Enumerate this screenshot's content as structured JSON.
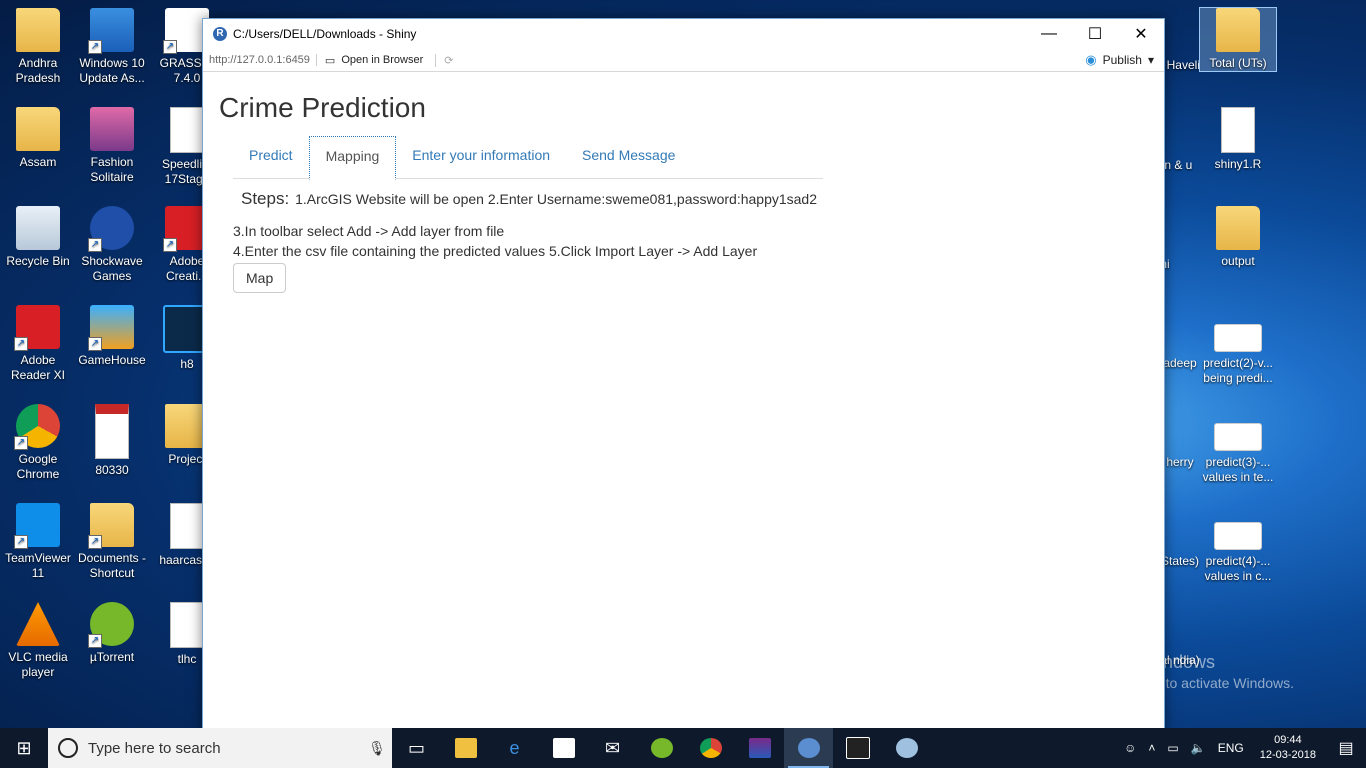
{
  "desktop_icons": [
    {
      "label": "Andhra Pradesh",
      "icon": "folder-icon"
    },
    {
      "label": "Windows 10 Update As...",
      "icon": "windows-update-icon"
    },
    {
      "label": "GRASS G 7.4.0",
      "icon": "grass-gis-icon"
    },
    {
      "label": "Assam",
      "icon": "folder-icon"
    },
    {
      "label": "Fashion Solitaire",
      "icon": "game-icon"
    },
    {
      "label": "Speedlim 17Stage",
      "icon": "file-icon"
    },
    {
      "label": "Recycle Bin",
      "icon": "recycle-bin-icon"
    },
    {
      "label": "Shockwave Games",
      "icon": "shockwave-icon"
    },
    {
      "label": "Adobe Creati...",
      "icon": "adobe-cc-icon"
    },
    {
      "label": "Adobe Reader XI",
      "icon": "adobe-reader-icon"
    },
    {
      "label": "GameHouse",
      "icon": "gamehouse-icon"
    },
    {
      "label": "h8",
      "icon": "photoshop-icon"
    },
    {
      "label": "Google Chrome",
      "icon": "chrome-icon"
    },
    {
      "label": "80330",
      "icon": "pdf-icon"
    },
    {
      "label": "Project",
      "icon": "folder-icon"
    },
    {
      "label": "TeamViewer 11",
      "icon": "teamviewer-icon"
    },
    {
      "label": "Documents - Shortcut",
      "icon": "documents-icon"
    },
    {
      "label": "haarcasca",
      "icon": "file-icon"
    },
    {
      "label": "VLC media player",
      "icon": "vlc-icon"
    },
    {
      "label": "µTorrent",
      "icon": "utorrent-icon"
    },
    {
      "label": "tlhc",
      "icon": "file-icon"
    }
  ],
  "desktop_icons_right": [
    {
      "label": "Haveli",
      "icon": "folder-icon"
    },
    {
      "label": "Total (UTs)",
      "icon": "folder-icon"
    },
    {
      "label": "an & u",
      "icon": "file-icon"
    },
    {
      "label": "shiny1.R",
      "icon": "file-icon"
    },
    {
      "label": "hi",
      "icon": "file-icon"
    },
    {
      "label": "output",
      "icon": "folder-icon"
    },
    {
      "label": "adeep",
      "icon": "file-icon"
    },
    {
      "label": "predict(2)-v... being predi...",
      "icon": "spreadsheet-icon"
    },
    {
      "label": "herry",
      "icon": "file-icon"
    },
    {
      "label": "predict(3)-... values in te...",
      "icon": "spreadsheet-icon"
    },
    {
      "label": "States)",
      "icon": "file-icon"
    },
    {
      "label": "predict(4)-... values in c...",
      "icon": "spreadsheet-icon"
    },
    {
      "label": "al ndia)",
      "icon": "file-icon"
    }
  ],
  "window": {
    "title": "C:/Users/DELL/Downloads - Shiny",
    "url": "http://127.0.0.1:6459",
    "open_in_browser": "Open in Browser",
    "publish": "Publish",
    "minimize": "—",
    "maximize": "☐",
    "close": "✕"
  },
  "app": {
    "title": "Crime Prediction",
    "tabs": [
      "Predict",
      "Mapping",
      "Enter your information",
      "Send Message"
    ],
    "active_tab": "Mapping",
    "steps_label": "Steps:",
    "steps_line1": "1.ArcGIS Website will be open 2.Enter Username:sweme081,password:happy1sad2",
    "steps_line2": "3.In toolbar select Add -> Add layer from file",
    "steps_line3": "4.Enter the csv file containing the predicted values 5.Click Import Layer -> Add Layer",
    "map_button": "Map"
  },
  "watermark": {
    "line1": "Activate Windows",
    "line2": "Go to Settings to activate Windows."
  },
  "taskbar": {
    "search_placeholder": "Type here to search",
    "language": "ENG",
    "time": "09:44",
    "date": "12-03-2018"
  }
}
